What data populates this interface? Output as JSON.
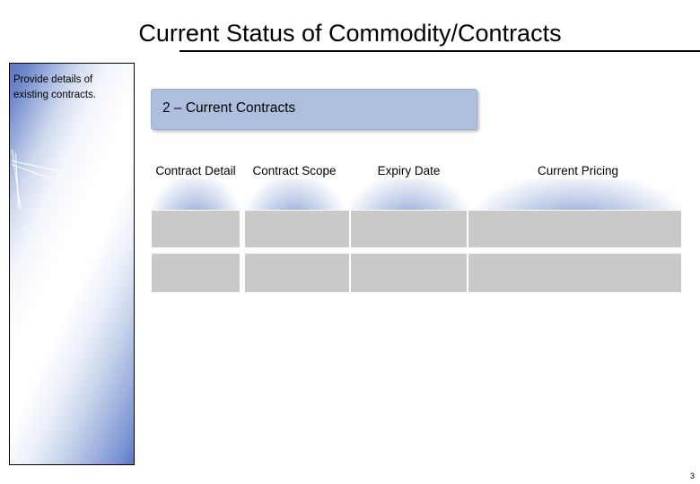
{
  "slide": {
    "title": "Current Status of Commodity/Contracts",
    "page_number": "3"
  },
  "note": {
    "text": "Provide details of existing contracts."
  },
  "section": {
    "label": "2 – Current Contracts"
  },
  "table": {
    "headers": [
      "Contract Detail",
      "Contract Scope",
      "Expiry Date",
      "Current Pricing"
    ],
    "rows": [
      [
        "",
        "",
        "",
        ""
      ],
      [
        "",
        "",
        "",
        ""
      ]
    ]
  },
  "colors": {
    "section_fill": "#aebfdd",
    "cell_fill": "#c9c9c9",
    "accent": "#4f6fc0"
  }
}
